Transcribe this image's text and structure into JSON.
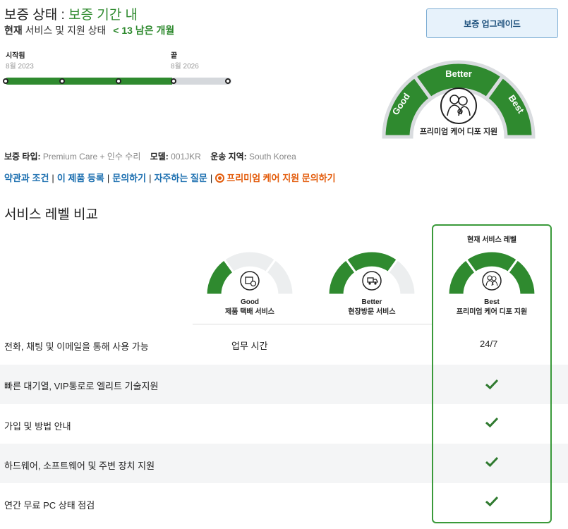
{
  "status": {
    "title_prefix": "보증 상태 :",
    "title_value": "보증 기간 내",
    "current_bold": "현재",
    "current_text": "서비스 및 지원 상태",
    "remaining": "< 13 남은 개월"
  },
  "upgrade_button": "보증 업그레이드",
  "timeline": {
    "start_label": "시작됨",
    "start_date": "8월 2023",
    "end_label": "끝",
    "end_date": "8월 2026",
    "progress_fraction": 0.74
  },
  "gauge": {
    "levels": [
      "Good",
      "Better",
      "Best"
    ],
    "active_level": "Best",
    "label": "프리미엄 케어 디포 지원",
    "icon": "support-agents-icon"
  },
  "info": {
    "type_label": "보증 타입:",
    "type_value": "Premium Care + 인수 수리",
    "model_label": "모델:",
    "model_value": "001JKR",
    "region_label": "운송 지역:",
    "region_value": "South Korea"
  },
  "links": {
    "terms": "약관과 조건",
    "register": "이 제품 등록",
    "contact": "문의하기",
    "faq": "자주하는 질문",
    "premium_contact": "프리미엄 케어 지원 문의하기"
  },
  "comparison": {
    "title": "서비스 레벨 비교",
    "current_label": "현재 서비스 레벨",
    "tiers": [
      {
        "level": "Good",
        "name": "제품 택배 서비스",
        "icon": "package-icon"
      },
      {
        "level": "Better",
        "name": "현장방문 서비스",
        "icon": "truck-icon"
      },
      {
        "level": "Best",
        "name": "프리미엄 케어 디포 지원",
        "icon": "support-agents-icon"
      }
    ],
    "rows": [
      {
        "label": "전화, 채팅 및 이메일을 통해 사용 가능",
        "good": "업무 시간",
        "best": "24/7"
      },
      {
        "label": "빠른 대기열, VIP통로로 엘리트 기술지원",
        "best_check": true
      },
      {
        "label": "가입 및 방법 안내",
        "best_check": true
      },
      {
        "label": "하드웨어, 소프트웨어 및 주변 장치 지원",
        "best_check": true
      },
      {
        "label": "연간 무료 PC 상태 점검",
        "best_check": true
      }
    ]
  },
  "colors": {
    "green": "#2f8a2f",
    "link_blue": "#1c6fb0",
    "orange": "#e35c0c",
    "track_gray": "#d5d8dc"
  }
}
